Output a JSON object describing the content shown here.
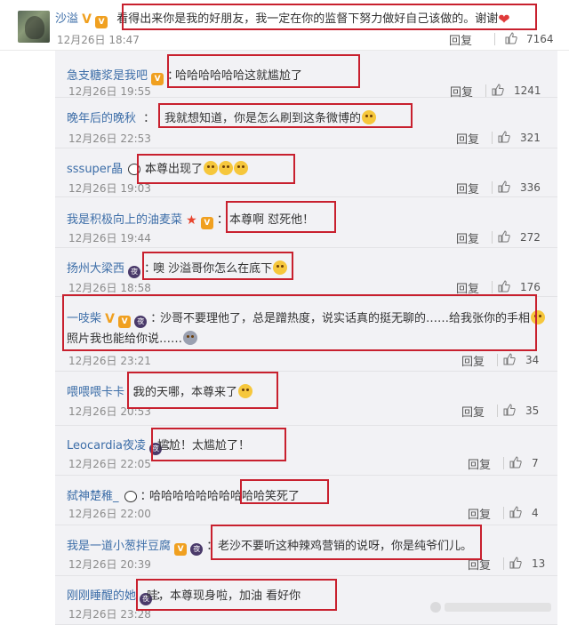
{
  "top": {
    "name": "沙溢",
    "text": "看得出来你是我的好朋友，我一定在你的监督下努力做好自己该做的。谢谢",
    "time": "12月26日 18:47",
    "reply": "回复",
    "likes": "7164"
  },
  "replies": [
    {
      "name": "急支糖浆是我吧",
      "text": "哈哈哈哈哈哈这就尴尬了",
      "time": "12月26日 19:55",
      "reply": "回复",
      "likes": "1241"
    },
    {
      "name": "晚年后的晚秋",
      "text": "我就想知道，你是怎么刷到这条微博的",
      "time": "12月26日 22:53",
      "reply": "回复",
      "likes": "321"
    },
    {
      "name": "sssuper晶",
      "text": "本尊出现了",
      "time": "12月26日 19:03",
      "reply": "回复",
      "likes": "336"
    },
    {
      "name": "我是积极向上的油麦菜",
      "text": "本尊啊 怼死他！",
      "time": "12月26日 19:44",
      "reply": "回复",
      "likes": "272"
    },
    {
      "name": "扬州大梁西",
      "text": "噢 沙溢哥你怎么在底下",
      "time": "12月26日 18:58",
      "reply": "回复",
      "likes": "176"
    },
    {
      "name": "一吱柴",
      "text": "沙哥不要理他了，总是蹭热度，说实话真的挺无聊的……给我张你的手相",
      "text2": "照片我也能给你说……",
      "time": "12月26日 23:21",
      "reply": "回复",
      "likes": "34"
    },
    {
      "name": "喂喂喂卡卡",
      "text": "我的天哪，本尊来了",
      "time": "12月26日 20:53",
      "reply": "回复",
      "likes": "35"
    },
    {
      "name": "Leocardia夜凌",
      "text": "尴尬！太尴尬了！",
      "time": "12月26日 22:05",
      "reply": "回复",
      "likes": "7"
    },
    {
      "name": "弑神楚稚_",
      "text": "哈哈哈哈哈哈哈哈哈哈笑死了",
      "time": "12月26日 22:00",
      "reply": "回复",
      "likes": "4"
    },
    {
      "name": "我是一道小葱拌豆腐",
      "text": "老沙不要听这种辣鸡营销的说呀，你是纯爷们儿。",
      "time": "12月26日 20:39",
      "reply": "回复",
      "likes": "13"
    },
    {
      "name": "刚刚睡醒的她",
      "text": "哇，本尊现身啦，加油 看好你",
      "time": "12月26日 23:28",
      "reply": "",
      "likes": ""
    }
  ],
  "colors": {
    "name": "#3d6ea8",
    "highlight": "#c8202e",
    "panel": "#f2f2f5"
  },
  "icons": {
    "like": "thumbs-up-icon",
    "heart": "heart-icon"
  }
}
